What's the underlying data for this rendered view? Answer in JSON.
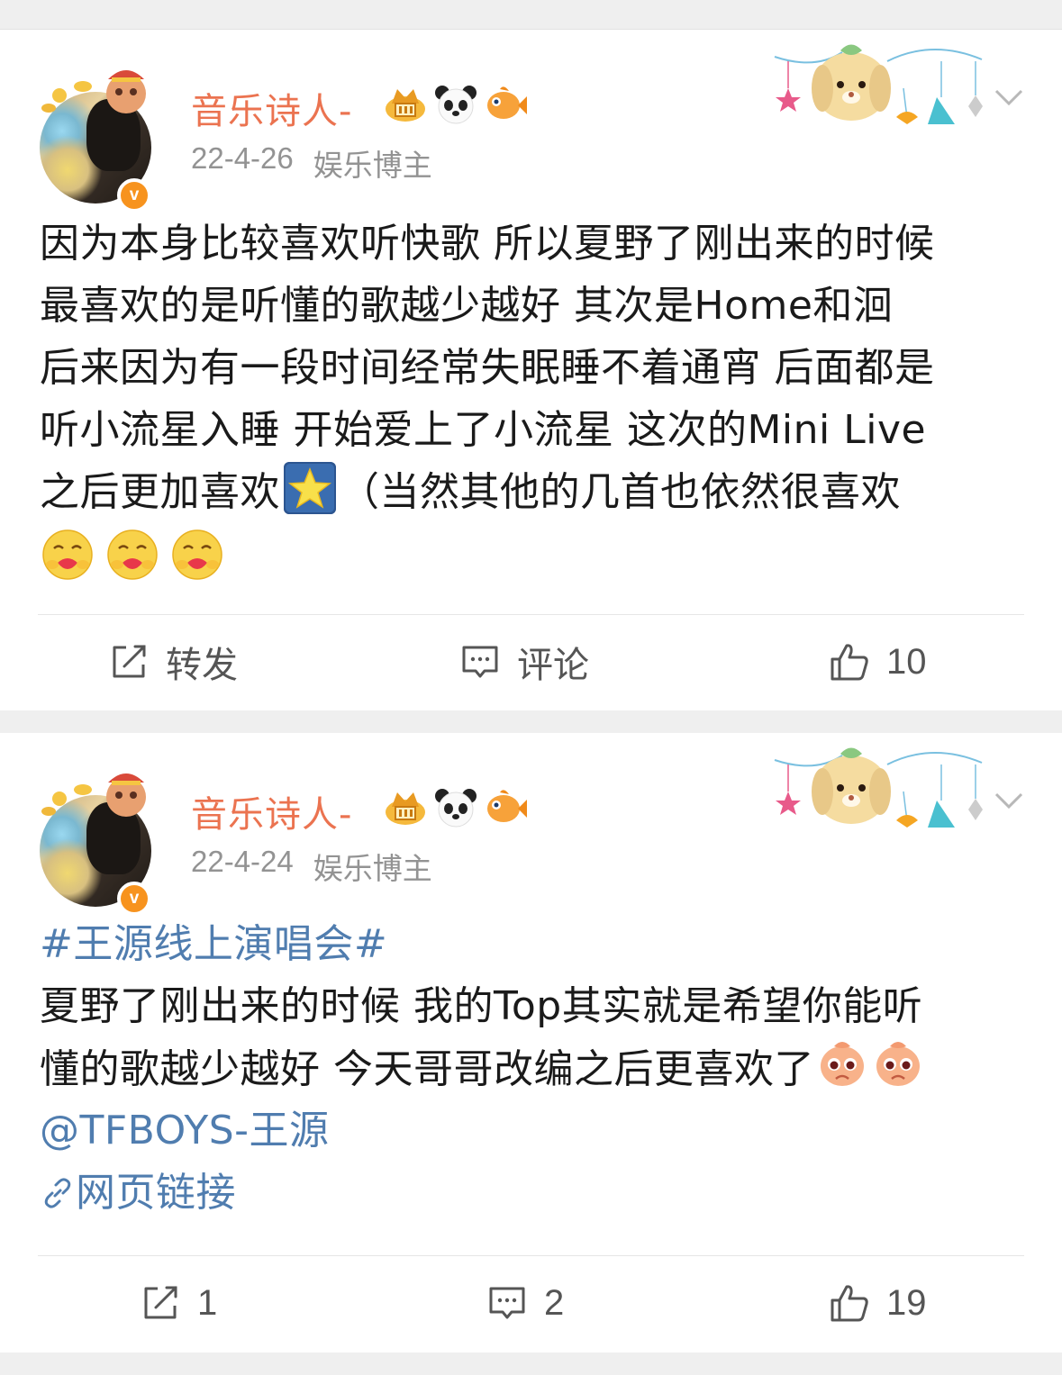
{
  "posts": [
    {
      "username": "音乐诗人-",
      "date": "22-4-26",
      "role": "娱乐博主",
      "badges": [
        "crown-badge-icon",
        "panda-badge-icon",
        "fish-badge-icon"
      ],
      "lines": [
        "因为本身比较喜欢听快歌 所以夏野了刚出来的时候",
        "最喜欢的是听懂的歌越少越好 其次是Home和洄",
        "后来因为有一段时间经常失眠睡不着通宵 后面都是",
        "听小流星入睡 开始爱上了小流星 这次的Mini Live"
      ],
      "line5_before": "之后更加喜欢",
      "line5_after": "（当然其他的几首也依然很喜欢",
      "emoji_icons": [
        "star-emoji-icon",
        "hug-emoji-icon"
      ],
      "actions": {
        "repost": "转发",
        "comment": "评论",
        "like": "10"
      }
    },
    {
      "username": "音乐诗人-",
      "date": "22-4-24",
      "role": "娱乐博主",
      "badges": [
        "crown-badge-icon",
        "panda-badge-icon",
        "fish-badge-icon"
      ],
      "hashtag": "#王源线上演唱会#",
      "lines": [
        "夏野了刚出来的时候 我的Top其实就是希望你能听"
      ],
      "line2": "懂的歌越少越好 今天哥哥改编之后更喜欢了",
      "emoji_icons": [
        "cute-emoji-icon"
      ],
      "mention": "@TFBOYS-王源",
      "weblink": "网页链接",
      "actions": {
        "repost": "1",
        "comment": "2",
        "like": "19"
      }
    }
  ],
  "colors": {
    "username": "#eb7350",
    "link": "#507daf",
    "meta": "#939393",
    "verified": "#f7931e"
  }
}
